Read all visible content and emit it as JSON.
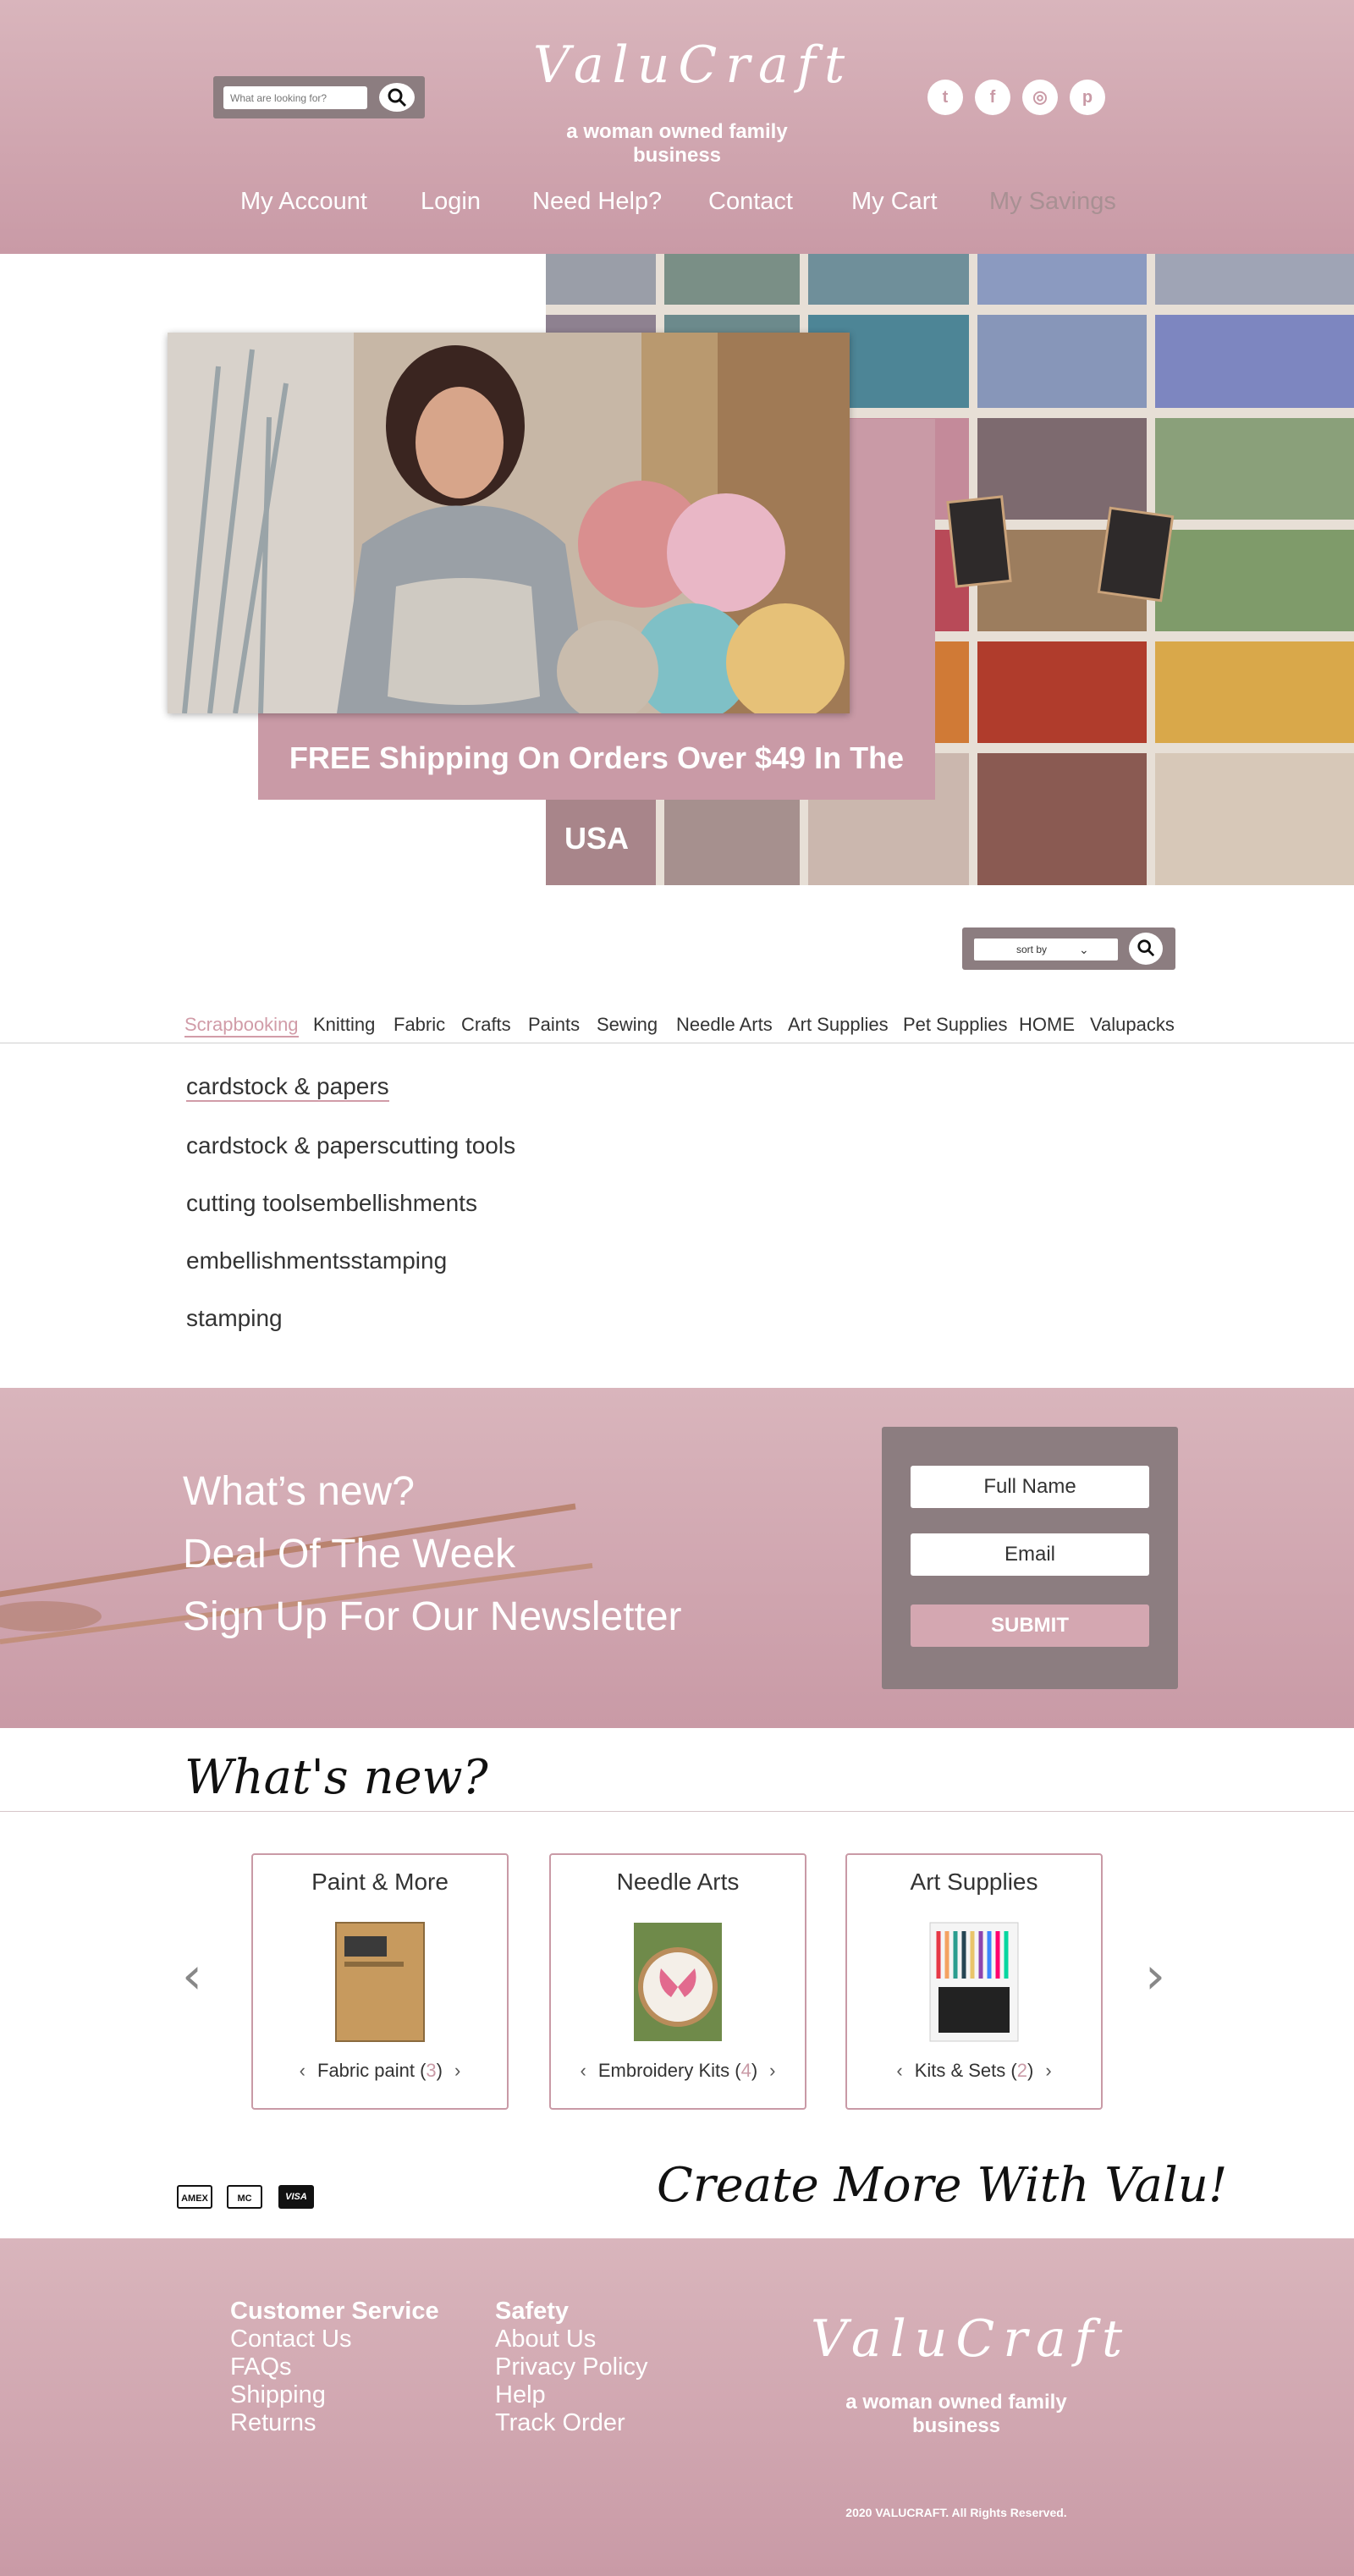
{
  "header": {
    "search_placeholder": "What are looking for?",
    "logo": "ValuCraft",
    "tagline": "a woman owned family business",
    "social": [
      "twitter-icon",
      "facebook-icon",
      "instagram-icon",
      "pinterest-icon"
    ],
    "nav": [
      "My Account",
      "Login",
      "Need Help?",
      "Contact",
      "My Cart",
      "My Savings"
    ]
  },
  "hero": {
    "shipping": "FREE Shipping On Orders Over $49 In The USA"
  },
  "sort": {
    "label": "sort by"
  },
  "categories": [
    "Scrapbooking",
    "Knitting",
    "Fabric",
    "Crafts",
    "Paints",
    "Sewing",
    "Needle Arts",
    "Art Supplies",
    "Pet Supplies",
    "HOME",
    "Valupacks"
  ],
  "subcategories": [
    "cardstock & papers",
    "cardstock & paperscutting tools",
    "cutting toolsembellishments",
    "embellishmentsstamping",
    "stamping"
  ],
  "newsletter": {
    "lines": [
      "What’s new?",
      "Deal Of The Week",
      "Sign Up For Our Newsletter"
    ],
    "full_name": "Full Name",
    "email": "Email",
    "submit": "SUBMIT"
  },
  "whats_new": {
    "title": "What's new?",
    "cards": [
      {
        "title": "Paint & More",
        "item": "Fabric paint",
        "count": "3"
      },
      {
        "title": "Needle Arts",
        "item": "Embroidery Kits",
        "count": "4"
      },
      {
        "title": "Art Supplies",
        "item": "Kits & Sets",
        "count": "2"
      }
    ]
  },
  "payments": [
    "AMEX",
    "MC",
    "VISA"
  ],
  "slogan": "Create More With Valu!",
  "footer": {
    "col1": [
      "Customer Service",
      "Contact Us",
      "FAQs",
      "Shipping",
      "Returns"
    ],
    "col2": [
      "Safety",
      "About Us",
      "Privacy Policy",
      "Help",
      "Track Order"
    ],
    "logo": "ValuCraft",
    "tagline": "a woman owned family business",
    "copyright": "2020 VALUCRAFT. All Rights Reserved."
  },
  "colors": {
    "brand_pink": "#c99aa6",
    "panel_gray": "#8c7d80"
  }
}
